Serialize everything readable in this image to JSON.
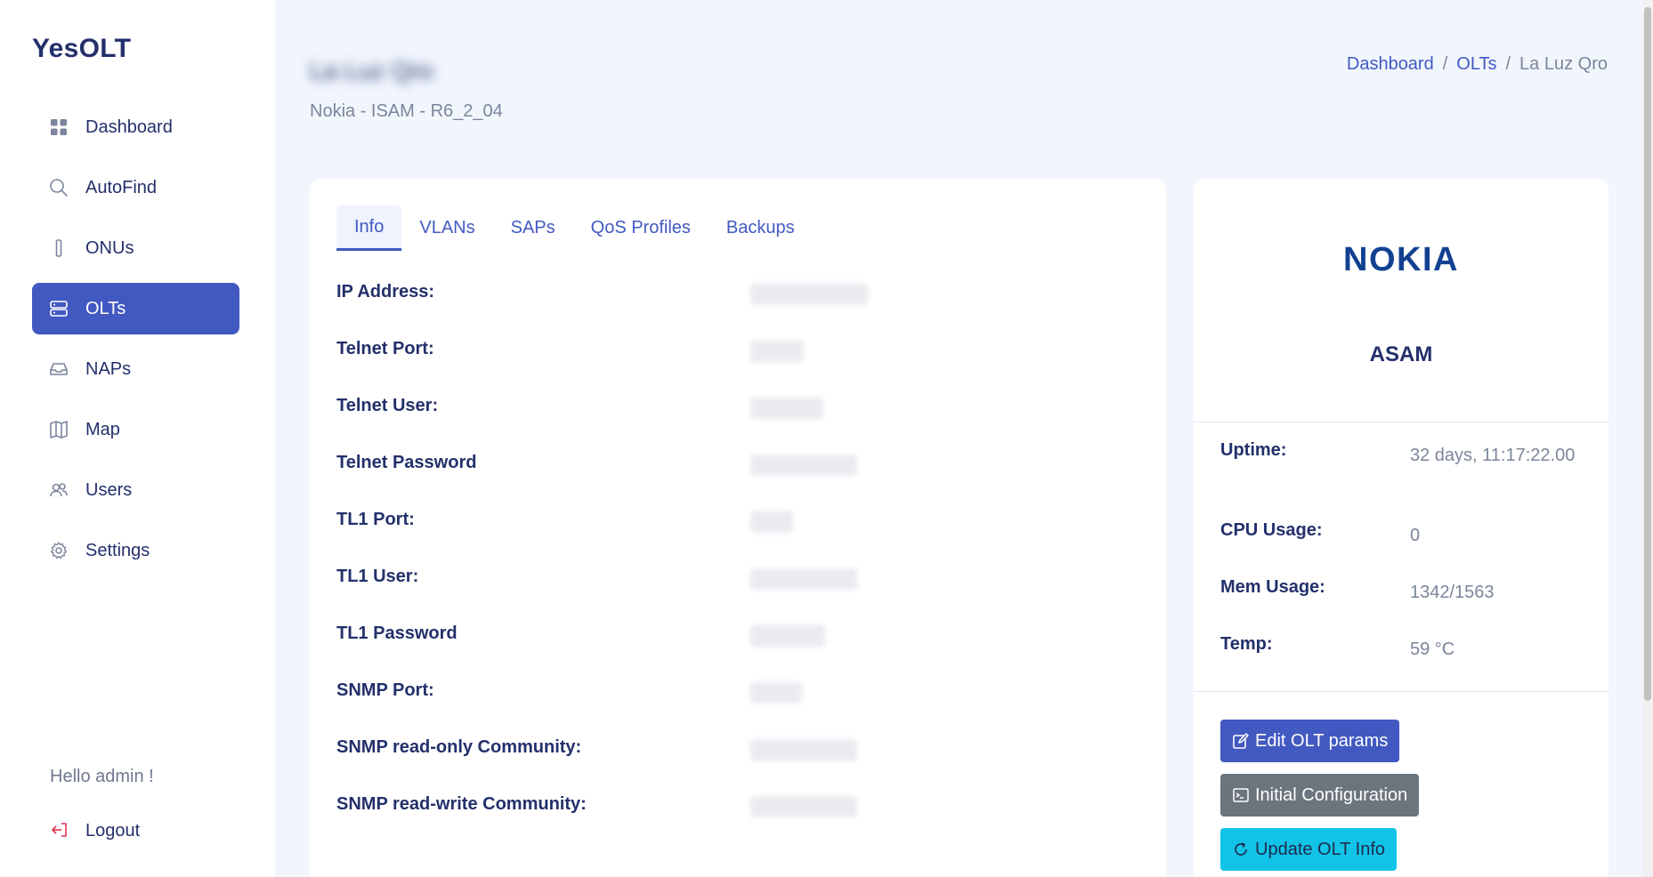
{
  "brand": "YesOLT",
  "sidebar": {
    "items": [
      {
        "label": "Dashboard",
        "icon": "grid-icon"
      },
      {
        "label": "AutoFind",
        "icon": "search-icon"
      },
      {
        "label": "ONUs",
        "icon": "device-icon"
      },
      {
        "label": "OLTs",
        "icon": "server-icon",
        "active": true
      },
      {
        "label": "NAPs",
        "icon": "inbox-icon"
      },
      {
        "label": "Map",
        "icon": "map-icon"
      },
      {
        "label": "Users",
        "icon": "users-icon"
      },
      {
        "label": "Settings",
        "icon": "gear-icon"
      }
    ],
    "greeting": "Hello admin !",
    "logout": "Logout"
  },
  "header": {
    "title": "La Luz Qro",
    "subtitle": "Nokia - ISAM - R6_2_04",
    "breadcrumb": [
      "Dashboard",
      "OLTs",
      "La Luz Qro"
    ]
  },
  "tabs": [
    "Info",
    "VLANs",
    "SAPs",
    "QoS Profiles",
    "Backups"
  ],
  "info": [
    {
      "label": "IP Address:"
    },
    {
      "label": "Telnet Port:"
    },
    {
      "label": "Telnet User:"
    },
    {
      "label": "Telnet Password"
    },
    {
      "label": "TL1 Port:"
    },
    {
      "label": "TL1 User:"
    },
    {
      "label": "TL1 Password"
    },
    {
      "label": "SNMP Port:"
    },
    {
      "label": "SNMP read-only Community:"
    },
    {
      "label": "SNMP read-write Community:"
    }
  ],
  "olt": {
    "logo_text": "NOKIA",
    "model": "ASAM",
    "stats": [
      {
        "label": "Uptime:",
        "value": "32 days, 11:17:22.00"
      },
      {
        "label": "CPU Usage:",
        "value": "0"
      },
      {
        "label": "Mem Usage:",
        "value": "1342/1563"
      },
      {
        "label": "Temp:",
        "value": "59 °C"
      }
    ],
    "buttons": {
      "edit": "Edit OLT params",
      "init": "Initial Configuration",
      "update": "Update OLT Info"
    }
  },
  "colors": {
    "accent": "#4259c1",
    "text": "#23306b",
    "muted": "#7b859c",
    "info_button": "#12c3e8",
    "secondary_button": "#6c757d"
  }
}
